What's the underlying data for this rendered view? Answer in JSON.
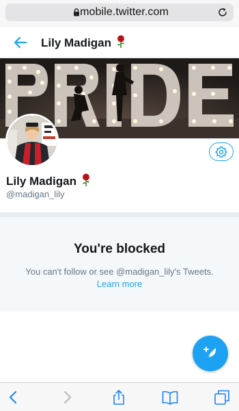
{
  "browser": {
    "url": "mobile.twitter.com",
    "lock_icon": "lock-icon",
    "reload_icon": "reload-icon"
  },
  "header": {
    "back_icon": "back-arrow-icon",
    "title": "Lily Madigan",
    "emoji_icon": "rose-icon"
  },
  "banner": {
    "alt_text": "PRIDE"
  },
  "profile": {
    "name": "Lily Madigan",
    "handle": "@madigan_lily",
    "settings_icon": "gear-icon"
  },
  "blocked": {
    "title": "You're blocked",
    "message": "You can't follow or see @madigan_lily's Tweets.",
    "learn_more": "Learn more"
  },
  "fab": {
    "icon": "compose-tweet-icon"
  },
  "toolbar": {
    "items": [
      {
        "icon": "back-chevron-icon"
      },
      {
        "icon": "forward-chevron-icon"
      },
      {
        "icon": "share-icon"
      },
      {
        "icon": "bookmarks-icon"
      },
      {
        "icon": "tabs-icon"
      }
    ]
  },
  "colors": {
    "accent": "#1da1f2",
    "text_primary": "#14171a",
    "text_secondary": "#657786",
    "panel_bg": "#f5f8fa",
    "divider": "#e6ecf0",
    "browser_chrome": "#f7f7f7"
  }
}
